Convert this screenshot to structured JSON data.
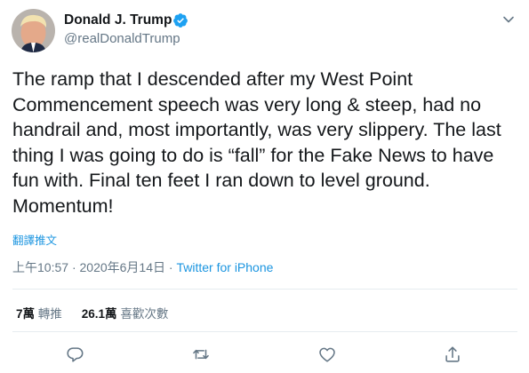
{
  "author": {
    "name": "Donald J. Trump",
    "handle": "@realDonaldTrump",
    "verified": true,
    "avatar_icon": "avatar-photo-icon"
  },
  "tweet": {
    "text": "The ramp that I descended after my West Point\nCommencement speech was very long & steep, had no\nhandrail and, most importantly, was very slippery. The last\nthing I was going to do is “fall” for the Fake News to have\nfun with. Final ten feet I ran down to level ground.\nMomentum!",
    "translate_label": "翻譯推文",
    "time": "上午10:57",
    "separator": "·",
    "date": "2020年6月14日",
    "via": "Twitter for iPhone"
  },
  "stats": {
    "retweets_count": "7萬",
    "retweets_label": "轉推",
    "likes_count": "26.1萬",
    "likes_label": "喜歡次數"
  },
  "actions": [
    "reply-icon",
    "retweet-icon",
    "like-icon",
    "share-icon"
  ],
  "colors": {
    "link": "#1b95e0",
    "secondary_text": "#657786",
    "primary_text": "#14171a",
    "verified": "#1da1f2"
  }
}
